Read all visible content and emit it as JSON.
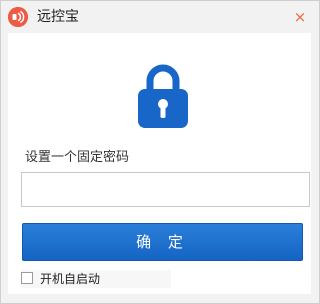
{
  "window": {
    "title": "远控宝",
    "close_symbol": "×",
    "logo_icon": "app-logo-icon"
  },
  "main": {
    "lock_icon": "lock-icon",
    "prompt": "设置一个固定密码",
    "password_value": "",
    "confirm_label": "确 定",
    "autostart_label": "开机自启动",
    "autostart_checked": false
  },
  "colors": {
    "accent": "#1a6fd0",
    "close": "#f06a3e",
    "logo": "#ef5a45"
  }
}
